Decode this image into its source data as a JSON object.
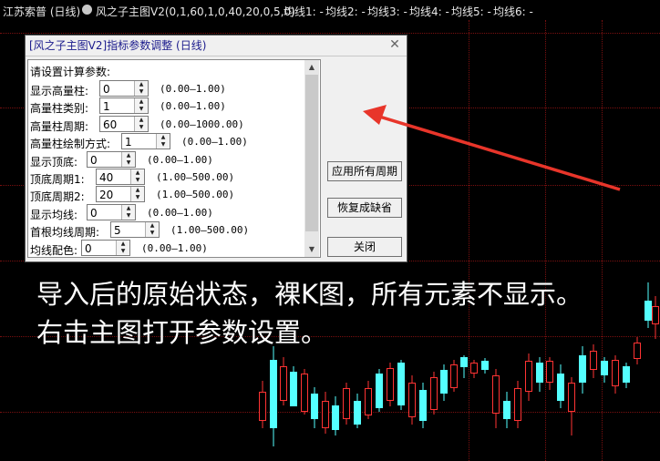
{
  "header": {
    "stock": "江苏索普 (日线)",
    "indicator": "风之子主图V2(0,1,60,1,0,40,20,0,5,0)",
    "ma_labels": [
      "均线1: -",
      "均线2: -",
      "均线3: -",
      "均线4: -",
      "均线5: -",
      "均线6: -"
    ],
    "indicator_icon": "circle-down-icon"
  },
  "dialog": {
    "title": "[风之子主图V2]指标参数调整 (日线)",
    "prompt": "请设置计算参数:",
    "params": [
      {
        "label": "显示高量柱:",
        "value": "0",
        "range": "(0.00—1.00)"
      },
      {
        "label": "高量柱类别:",
        "value": "1",
        "range": "(0.00—1.00)"
      },
      {
        "label": "高量柱周期:",
        "value": "60",
        "range": "(0.00—1000.00)"
      },
      {
        "label": "高量柱绘制方式:",
        "value": "1",
        "range": "(0.00—1.00)"
      },
      {
        "label": "显示顶底:",
        "value": "0",
        "range": "(0.00—1.00)"
      },
      {
        "label": "顶底周期1:",
        "value": "40",
        "range": "(1.00—500.00)"
      },
      {
        "label": "顶底周期2:",
        "value": "20",
        "range": "(1.00—500.00)"
      },
      {
        "label": "显示均线:",
        "value": "0",
        "range": "(0.00—1.00)"
      },
      {
        "label": "首根均线周期:",
        "value": "5",
        "range": "(1.00—500.00)"
      },
      {
        "label": "均线配色:",
        "value": "0",
        "range": "(0.00—1.00)"
      }
    ],
    "buttons": {
      "apply_all": "应用所有周期",
      "restore": "恢复成缺省",
      "close": "关闭"
    }
  },
  "caption": {
    "line1": "导入后的原始状态，裸K图，所有元素不显示。",
    "line2": "右击主图打开参数设置。"
  },
  "colors": {
    "arrow": "#e8352a",
    "up": "#ff3333",
    "down": "#54ffff",
    "background": "#000000"
  }
}
